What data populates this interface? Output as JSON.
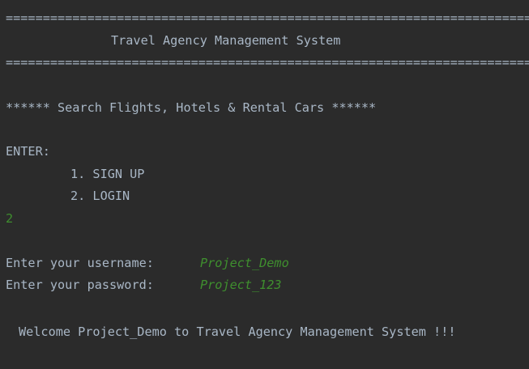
{
  "console": {
    "rule": "================================================================================",
    "title": "Travel Agency Management System",
    "banner": "****** Search Flights, Hotels & Rental Cars ******",
    "enter_prompt": "ENTER:",
    "menu": [
      {
        "label": "1. SIGN UP"
      },
      {
        "label": "2. LOGIN"
      }
    ],
    "user_choice": "2",
    "username_prompt": "Enter your username:",
    "username_value": "Project_Demo",
    "password_prompt": "Enter your password:",
    "password_value": "Project_123",
    "welcome_message": "Welcome Project_Demo to Travel Agency Management System !!!"
  },
  "colors": {
    "background": "#2b2b2b",
    "text": "#a9b7c6",
    "user_input": "#3f8f2e"
  }
}
